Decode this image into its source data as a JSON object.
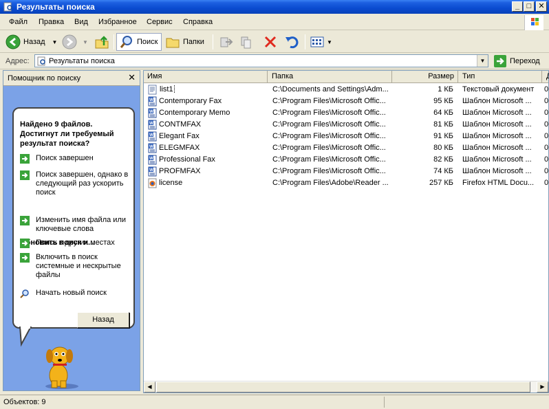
{
  "window": {
    "title": "Результаты поиска"
  },
  "menu": [
    "Файл",
    "Правка",
    "Вид",
    "Избранное",
    "Сервис",
    "Справка"
  ],
  "toolbar": {
    "back_label": "Назад",
    "search_label": "Поиск",
    "folders_label": "Папки"
  },
  "address": {
    "label": "Адрес:",
    "value": "Результаты поиска",
    "go_label": "Переход"
  },
  "assistant": {
    "header": "Помощник по поиску",
    "found_text": "Найдено 9 файлов. Достигнут ли требуемый результат поиска?",
    "options1": [
      "Поиск завершен",
      "Поиск завершен, однако в следующий раз ускорить поиск"
    ],
    "refine_heading": "Обновить поиск и...",
    "options2": [
      "Изменить имя файла или ключевые слова",
      "Поиск в других местах",
      "Включить в поиск системные и нескрытые файлы"
    ],
    "new_search": "Начать новый поиск",
    "back_button": "Назад"
  },
  "columns": [
    "Имя",
    "Папка",
    "Размер",
    "Тип",
    "Д"
  ],
  "files": [
    {
      "name": "list1",
      "folder": "C:\\Documents and Settings\\Adm...",
      "size": "1 КБ",
      "type": "Текстовый документ",
      "extra": "0",
      "icon": "text-file-icon"
    },
    {
      "name": "Contemporary Fax",
      "folder": "C:\\Program Files\\Microsoft Offic...",
      "size": "95 КБ",
      "type": "Шаблон Microsoft ...",
      "extra": "0",
      "icon": "word-template-icon"
    },
    {
      "name": "Contemporary Memo",
      "folder": "C:\\Program Files\\Microsoft Offic...",
      "size": "64 КБ",
      "type": "Шаблон Microsoft ...",
      "extra": "0",
      "icon": "word-template-icon"
    },
    {
      "name": "CONTMFAX",
      "folder": "C:\\Program Files\\Microsoft Offic...",
      "size": "81 КБ",
      "type": "Шаблон Microsoft ...",
      "extra": "0",
      "icon": "word-template-icon"
    },
    {
      "name": "Elegant Fax",
      "folder": "C:\\Program Files\\Microsoft Offic...",
      "size": "91 КБ",
      "type": "Шаблон Microsoft ...",
      "extra": "0",
      "icon": "word-template-icon"
    },
    {
      "name": "ELEGMFAX",
      "folder": "C:\\Program Files\\Microsoft Offic...",
      "size": "80 КБ",
      "type": "Шаблон Microsoft ...",
      "extra": "0",
      "icon": "word-template-icon"
    },
    {
      "name": "Professional Fax",
      "folder": "C:\\Program Files\\Microsoft Offic...",
      "size": "82 КБ",
      "type": "Шаблон Microsoft ...",
      "extra": "0",
      "icon": "word-template-icon"
    },
    {
      "name": "PROFMFAX",
      "folder": "C:\\Program Files\\Microsoft Offic...",
      "size": "74 КБ",
      "type": "Шаблон Microsoft ...",
      "extra": "0",
      "icon": "word-template-icon"
    },
    {
      "name": "license",
      "folder": "C:\\Program Files\\Adobe\\Reader ...",
      "size": "257 КБ",
      "type": "Firefox HTML Docu...",
      "extra": "0",
      "icon": "html-file-icon"
    }
  ],
  "status": {
    "text": "Объектов: 9"
  }
}
